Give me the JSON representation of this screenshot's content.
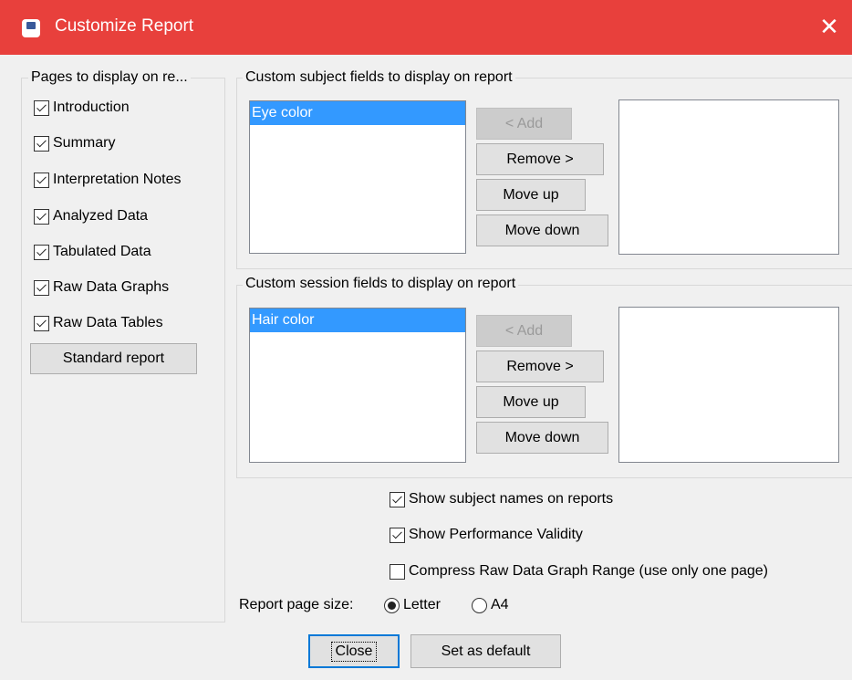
{
  "window": {
    "title": "Customize Report",
    "close_label": "✕"
  },
  "pages_group": {
    "label": "Pages to display on re...",
    "items": [
      {
        "label": "Introduction",
        "checked": true
      },
      {
        "label": "Summary",
        "checked": true
      },
      {
        "label": "Interpretation Notes",
        "checked": true
      },
      {
        "label": "Analyzed Data",
        "checked": true
      },
      {
        "label": "Tabulated Data",
        "checked": true
      },
      {
        "label": "Raw Data Graphs",
        "checked": true
      },
      {
        "label": "Raw Data Tables",
        "checked": true
      }
    ],
    "standard_report_label": "Standard report"
  },
  "subject_group": {
    "label": "Custom subject fields to display on report",
    "left_list": [
      "Eye color"
    ],
    "right_list": [],
    "add_label": "< Add",
    "remove_label": "Remove >",
    "move_up_label": "Move up",
    "move_down_label": "Move down"
  },
  "session_group": {
    "label": "Custom session fields to display on report",
    "left_list": [
      "Hair color"
    ],
    "right_list": [],
    "add_label": "< Add",
    "remove_label": "Remove >",
    "move_up_label": "Move up",
    "move_down_label": "Move down"
  },
  "options": {
    "show_subject_names": {
      "label": "Show subject names on reports",
      "checked": true
    },
    "show_performance_validity": {
      "label": "Show Performance Validity",
      "checked": true
    },
    "compress_raw_graph": {
      "label": "Compress Raw Data Graph Range (use only one page)",
      "checked": false
    }
  },
  "page_size": {
    "label": "Report page size:",
    "options": [
      {
        "label": "Letter",
        "selected": true
      },
      {
        "label": "A4",
        "selected": false
      }
    ]
  },
  "footer": {
    "close_label": "Close",
    "set_default_label": "Set as default"
  },
  "colors": {
    "titlebar": "#e8403c",
    "selection": "#3399ff",
    "background": "#f0f0f0"
  }
}
